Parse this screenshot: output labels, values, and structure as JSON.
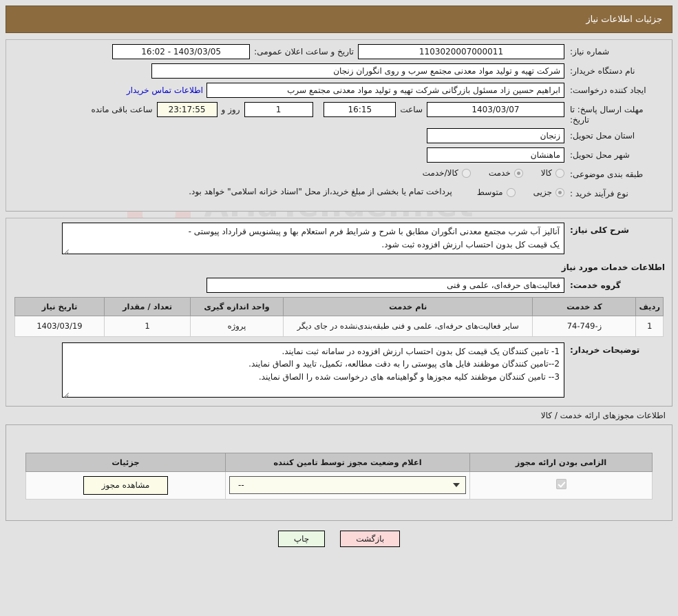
{
  "header": {
    "title": "جزئیات اطلاعات نیاز"
  },
  "watermark": {
    "text": "AriaTender.net"
  },
  "form": {
    "need_number_label": "شماره نیاز:",
    "need_number_value": "1103020007000011",
    "announce_label": "تاریخ و ساعت اعلان عمومی:",
    "announce_value": "1403/03/05 - 16:02",
    "buyer_org_label": "نام دستگاه خریدار:",
    "buyer_org_value": "شرکت تهیه و تولید مواد معدنی مجتمع سرب و روی انگوران   زنجان",
    "creator_label": "ایجاد کننده درخواست:",
    "creator_value": "ابراهیم حسین زاد مسئول بازرگانی شرکت تهیه و تولید مواد معدنی مجتمع سرب",
    "contact_link": "اطلاعات تماس خریدار",
    "deadline_label": "مهلت ارسال پاسخ: تا تاریخ:",
    "deadline_date": "1403/03/07",
    "hour_label": "ساعت",
    "deadline_time": "16:15",
    "days_value": "1",
    "days_label": "روز و",
    "countdown_value": "23:17:55",
    "countdown_label": "ساعت باقی مانده",
    "province_label": "استان محل تحویل:",
    "province_value": "زنجان",
    "city_label": "شهر محل تحویل:",
    "city_value": "ماهنشان",
    "category_label": "طبقه بندی موضوعی:",
    "category_options": [
      {
        "label": "کالا",
        "selected": false
      },
      {
        "label": "خدمت",
        "selected": true
      },
      {
        "label": "کالا/خدمت",
        "selected": false
      }
    ],
    "process_label": "نوع فرآیند خرید :",
    "process_options": [
      {
        "label": "جزیی",
        "selected": true
      },
      {
        "label": "متوسط",
        "selected": false
      }
    ],
    "process_note": "پرداخت تمام یا بخشی از مبلغ خرید،از محل \"اسناد خزانه اسلامی\" خواهد بود."
  },
  "description": {
    "label": "شرح کلی نیاز:",
    "value": "آنالیز آب شرب مجتمع معدنی انگوران مطابق با شرح و شرایط فرم استعلام بها و پیشنویس قرارداد پیوستی -\nیک قیمت کل بدون احتساب ارزش افزوده ثبت شود."
  },
  "services_section": {
    "heading": "اطلاعات خدمات مورد نیاز",
    "group_label": "گروه خدمت:",
    "group_value": "فعالیت‌های حرفه‌ای، علمی و فنی",
    "table": {
      "columns": [
        "ردیف",
        "کد خدمت",
        "نام خدمت",
        "واحد اندازه گیری",
        "تعداد / مقدار",
        "تاریخ نیاز"
      ],
      "rows": [
        {
          "row": "1",
          "code": "ز-749-74",
          "name": "سایر فعالیت‌های حرفه‌ای، علمی و فنی طبقه‌بندی‌نشده در جای دیگر",
          "unit": "پروژه",
          "qty": "1",
          "date": "1403/03/19"
        }
      ]
    }
  },
  "buyer_notes": {
    "label": "توضیحات خریدار:",
    "value": "1- تامین کنندگان یک قیمت کل بدون احتساب ارزش افزوده در سامانه ثبت نمایند.\n2--تامین کنندگان موظفند فایل های پیوستی را به دقت مطالعه، تکمیل، تایید و الصاق نمایند.\n3-- تامین کنندگان موظفند کلیه مجوزها و گواهینامه های درخواست شده را الصاق نمایند."
  },
  "permits_section": {
    "heading": "اطلاعات مجوزهای ارائه خدمت / کالا",
    "table": {
      "columns": [
        "الزامی بودن ارائه مجوز",
        "اعلام وضعیت مجوز توسط تامین کننده",
        "جزئیات"
      ],
      "rows": [
        {
          "required_checked": true,
          "status_value": "--",
          "details_button": "مشاهده مجوز"
        }
      ]
    }
  },
  "footer": {
    "back_button": "بازگشت",
    "print_button": "چاپ"
  },
  "colors": {
    "header_bar": "#8c6b3f",
    "page_bg": "#e2e2e2",
    "link": "#0000cc",
    "table_header": "#c6c6c6",
    "cream_field": "#fbfbe8",
    "back_button": "#fbd9d9",
    "print_button": "#e9f7e3"
  }
}
